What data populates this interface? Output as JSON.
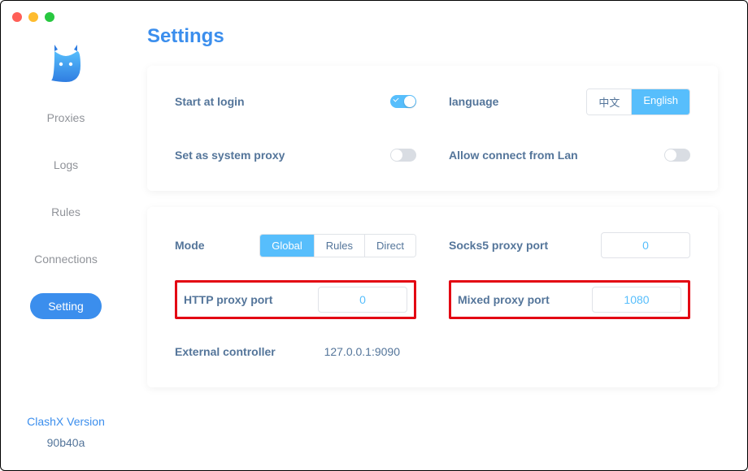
{
  "sidebar": {
    "items": [
      {
        "label": "Proxies"
      },
      {
        "label": "Logs"
      },
      {
        "label": "Rules"
      },
      {
        "label": "Connections"
      },
      {
        "label": "Setting"
      }
    ]
  },
  "version": {
    "label": "ClashX Version",
    "value": "90b40a"
  },
  "page_title": "Settings",
  "card1": {
    "start_at_login": {
      "label": "Start at login",
      "on": true
    },
    "language": {
      "label": "language",
      "options": [
        "中文",
        "English"
      ],
      "active": "English"
    },
    "system_proxy": {
      "label": "Set as system proxy",
      "on": false
    },
    "allow_lan": {
      "label": "Allow connect from Lan",
      "on": false
    }
  },
  "card2": {
    "mode": {
      "label": "Mode",
      "options": [
        "Global",
        "Rules",
        "Direct"
      ],
      "active": "Global"
    },
    "socks5": {
      "label": "Socks5 proxy port",
      "value": "0"
    },
    "http": {
      "label": "HTTP proxy port",
      "value": "0"
    },
    "mixed": {
      "label": "Mixed proxy port",
      "value": "1080"
    },
    "external": {
      "label": "External controller",
      "value": "127.0.0.1:9090"
    }
  }
}
